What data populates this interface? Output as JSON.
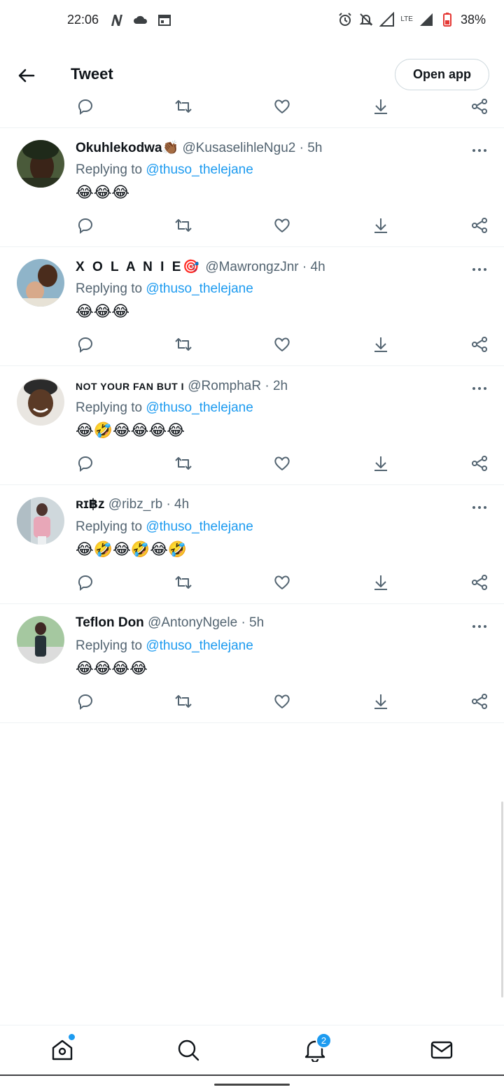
{
  "status_bar": {
    "time": "22:06",
    "battery": "38%",
    "network": "LTE"
  },
  "header": {
    "title": "Tweet",
    "open_app_label": "Open app"
  },
  "colors": {
    "accent": "#1d9bf0",
    "text_primary": "#0f1419",
    "text_secondary": "#536471"
  },
  "tweets": [
    {
      "name": "Okuhlekodwa👏🏾",
      "handle": "@KusaselihleNgu2",
      "time": "· 5h",
      "replying_prefix": "Replying to ",
      "replying_to": "@thuso_thelejane",
      "body": "😂😂😂"
    },
    {
      "name": "X O L A N I E🎯",
      "handle": "@MawrongzJnr",
      "time": "· 4h",
      "replying_prefix": "Replying to ",
      "replying_to": "@thuso_thelejane",
      "body": "😂😂😂"
    },
    {
      "name": "NOT YOUR FAN BUT I",
      "handle": "@RomphaR",
      "time": "· 2h",
      "replying_prefix": "Replying to ",
      "replying_to": "@thuso_thelejane",
      "body": "😂🤣😂😂😂😂"
    },
    {
      "name": "ʀɪ฿ᴢ",
      "handle": "@ribz_rb",
      "time": "· 4h",
      "replying_prefix": "Replying to ",
      "replying_to": "@thuso_thelejane",
      "body": "😂🤣😂🤣😂🤣"
    },
    {
      "name": "Teflon Don",
      "handle": "@AntonyNgele",
      "time": "· 5h",
      "replying_prefix": "Replying to ",
      "replying_to": "@thuso_thelejane",
      "body": "😂😂😂😂"
    }
  ],
  "bottom_nav": {
    "notification_count": "2",
    "items": [
      "home-icon",
      "search-icon",
      "bell-icon",
      "mail-icon"
    ]
  }
}
